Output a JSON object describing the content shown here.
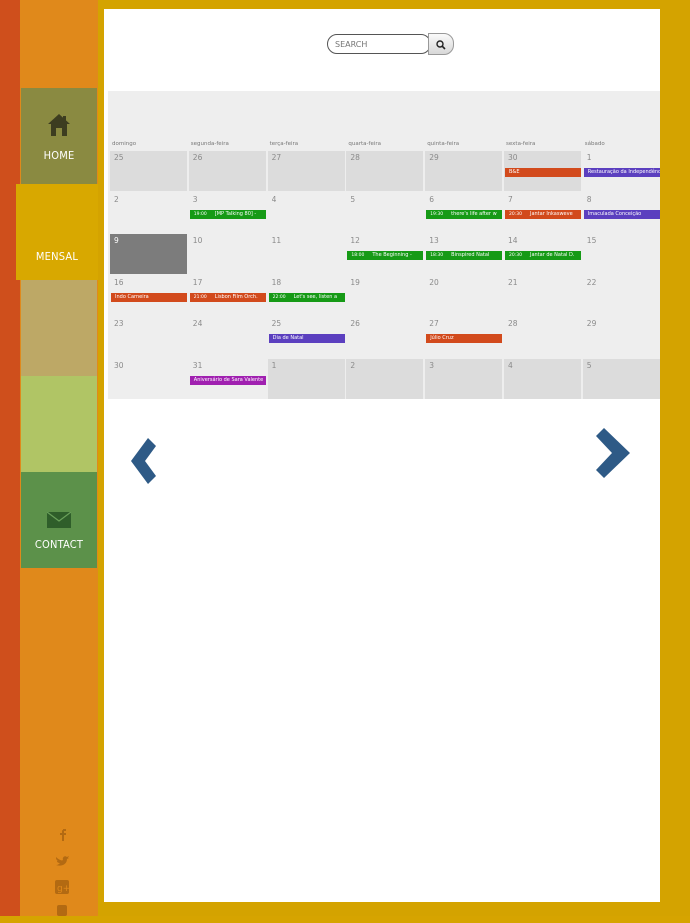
{
  "nav": {
    "home_label": "HOME",
    "mensal_label": "MENSAL",
    "contact_label": "CONTACT"
  },
  "social": [
    "facebook-icon",
    "twitter-icon",
    "google-plus-icon",
    "youtube-icon"
  ],
  "search": {
    "placeholder": "SEARCH"
  },
  "calendar": {
    "weekdays": [
      "domingo",
      "segunda-feira",
      "terça-feira",
      "quarta-feira",
      "quinta-feira",
      "sexta-feira",
      "sábado"
    ],
    "weeks": [
      [
        {
          "d": "25",
          "other": true,
          "events": []
        },
        {
          "d": "26",
          "other": true,
          "events": []
        },
        {
          "d": "27",
          "other": true,
          "events": []
        },
        {
          "d": "28",
          "other": true,
          "events": []
        },
        {
          "d": "29",
          "other": true,
          "events": []
        },
        {
          "d": "30",
          "other": true,
          "events": [
            {
              "t": "B&E",
              "c": "#d24a1c"
            }
          ]
        },
        {
          "d": "1",
          "other": false,
          "events": [
            {
              "t": "Restauração da Independência",
              "c": "#5b3fbf"
            }
          ]
        }
      ],
      [
        {
          "d": "2",
          "other": false,
          "events": []
        },
        {
          "d": "3",
          "other": false,
          "events": [
            {
              "time": "19:00",
              "t": "[MP Talking 80] -",
              "c": "#169a16"
            }
          ]
        },
        {
          "d": "4",
          "other": false,
          "events": []
        },
        {
          "d": "5",
          "other": false,
          "events": []
        },
        {
          "d": "6",
          "other": false,
          "events": [
            {
              "time": "19:30",
              "t": "there's life after w",
              "c": "#169a16"
            }
          ]
        },
        {
          "d": "7",
          "other": false,
          "events": [
            {
              "time": "20:30",
              "t": "Jantar Inkasweve",
              "c": "#d24a1c"
            }
          ]
        },
        {
          "d": "8",
          "other": false,
          "events": [
            {
              "t": "Imaculada Conceição",
              "c": "#5b3fbf"
            }
          ]
        }
      ],
      [
        {
          "d": "9",
          "other": false,
          "today": true,
          "events": []
        },
        {
          "d": "10",
          "other": false,
          "events": []
        },
        {
          "d": "11",
          "other": false,
          "events": []
        },
        {
          "d": "12",
          "other": false,
          "events": [
            {
              "time": "18:00",
              "t": "The Beginning -",
              "c": "#169a16"
            }
          ]
        },
        {
          "d": "13",
          "other": false,
          "events": [
            {
              "time": "18:30",
              "t": "Binspired Natal",
              "c": "#169a16"
            }
          ]
        },
        {
          "d": "14",
          "other": false,
          "events": [
            {
              "time": "20:30",
              "t": "Jantar de Natal D.",
              "c": "#169a16"
            }
          ]
        },
        {
          "d": "15",
          "other": false,
          "events": []
        }
      ],
      [
        {
          "d": "16",
          "other": false,
          "events": [
            {
              "t": "Indo Carneira",
              "c": "#d24a1c"
            }
          ]
        },
        {
          "d": "17",
          "other": false,
          "events": [
            {
              "time": "21:00",
              "t": "Lisbon Film Orch.",
              "c": "#d24a1c"
            }
          ]
        },
        {
          "d": "18",
          "other": false,
          "events": [
            {
              "time": "22:00",
              "t": "Let's see, listen a",
              "c": "#169a16"
            }
          ]
        },
        {
          "d": "19",
          "other": false,
          "events": []
        },
        {
          "d": "20",
          "other": false,
          "events": []
        },
        {
          "d": "21",
          "other": false,
          "events": []
        },
        {
          "d": "22",
          "other": false,
          "events": []
        }
      ],
      [
        {
          "d": "23",
          "other": false,
          "events": []
        },
        {
          "d": "24",
          "other": false,
          "events": []
        },
        {
          "d": "25",
          "other": false,
          "events": [
            {
              "t": "Dia de Natal",
              "c": "#5b3fbf"
            }
          ]
        },
        {
          "d": "26",
          "other": false,
          "events": []
        },
        {
          "d": "27",
          "other": false,
          "events": [
            {
              "t": "Júlio Cruz",
              "c": "#d24a1c"
            }
          ]
        },
        {
          "d": "28",
          "other": false,
          "events": []
        },
        {
          "d": "29",
          "other": false,
          "events": []
        }
      ],
      [
        {
          "d": "30",
          "other": false,
          "events": []
        },
        {
          "d": "31",
          "other": false,
          "events": [
            {
              "t": "Aniversário de Sara Valente",
              "c": "#a020b0"
            }
          ]
        },
        {
          "d": "1",
          "other": true,
          "events": []
        },
        {
          "d": "2",
          "other": true,
          "events": []
        },
        {
          "d": "3",
          "other": true,
          "events": []
        },
        {
          "d": "4",
          "other": true,
          "events": []
        },
        {
          "d": "5",
          "other": true,
          "events": []
        }
      ]
    ]
  },
  "colors": {
    "accent_blue": "#2e5a86",
    "event_green": "#169a16",
    "event_orange": "#d24a1c",
    "event_purple": "#5b3fbf"
  }
}
